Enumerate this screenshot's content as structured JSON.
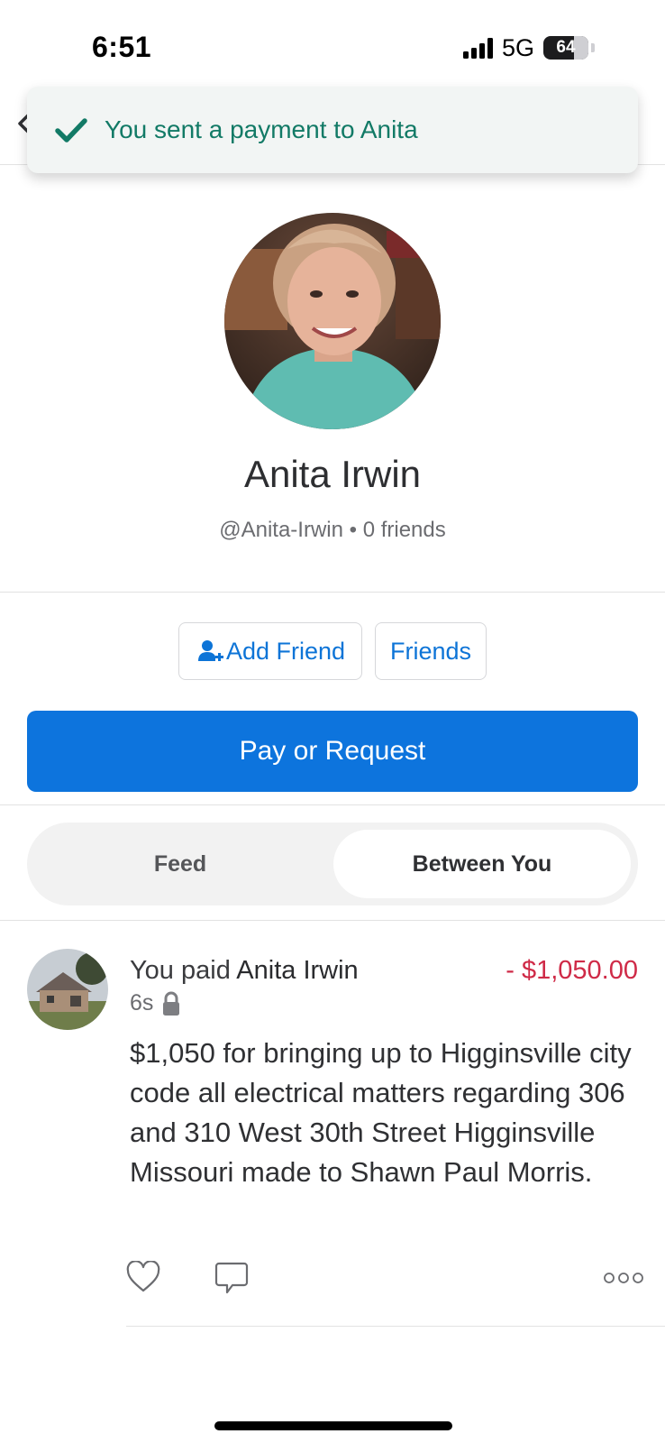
{
  "status_bar": {
    "time": "6:51",
    "network": "5G",
    "battery": "64"
  },
  "toast": {
    "message": "You sent a payment to Anita",
    "accent_color": "#127a66",
    "icon": "checkmark-icon"
  },
  "profile": {
    "name": "Anita Irwin",
    "meta": "@Anita-Irwin • 0 friends",
    "avatar": "profile-photo"
  },
  "buttons": {
    "add_friend": "Add Friend",
    "friends": "Friends",
    "pay_or_request": "Pay or Request",
    "primary_color": "#0d74dd",
    "link_color": "#0d74d7"
  },
  "tabs": {
    "feed": "Feed",
    "between_you": "Between You",
    "selected": "Between You"
  },
  "transaction": {
    "prefix": "You paid",
    "recipient": "Anita Irwin",
    "amount": "- $1,050.00",
    "amount_color": "#cf2a47",
    "time": "6s",
    "privacy": "lock-icon",
    "note": "$1,050 for bringing up to Higginsville city code all electrical matters regarding 306 and 310 West 30th Street Higginsville Missouri made to Shawn Paul Morris.",
    "actions": [
      "heart-icon",
      "comment-icon",
      "more-icon"
    ]
  }
}
